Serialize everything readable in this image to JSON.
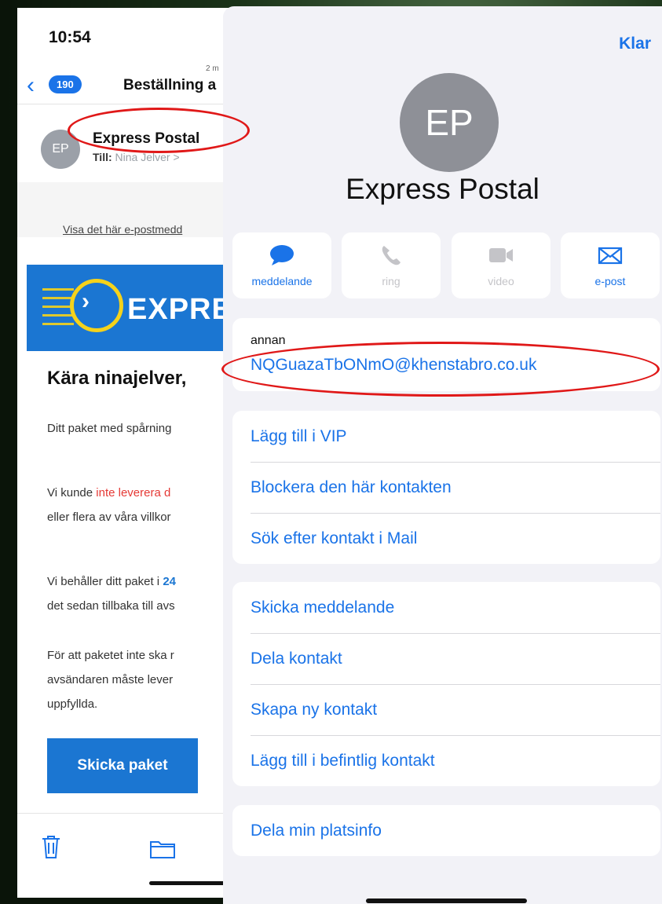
{
  "mail": {
    "status_time": "10:54",
    "back_count": "190",
    "subject_title": "Beställning a",
    "timestamp_fragment": "2 m",
    "sender_initials": "EP",
    "sender_name": "Express Postal",
    "to_label": "Till:",
    "to_value": "Nina Jelver >",
    "view_link": "Visa det här e-postmedd",
    "banner_text": "EXPRES",
    "greeting": "Kära ninajelver,",
    "p1": "Ditt paket med spårning",
    "p2a_prefix": "Vi kunde ",
    "p2a_red": "inte leverera d",
    "p2b": "eller flera av våra villkor",
    "p3a_prefix": "Vi behåller ditt paket i ",
    "p3a_blue": "24",
    "p3b": "det sedan tillbaka till avs",
    "p4a": "För att paketet inte ska r",
    "p4b": "avsändaren måste lever",
    "p4c": "uppfyllda.",
    "send_button": "Skicka paket"
  },
  "contact": {
    "done_label": "Klar",
    "initials": "EP",
    "name": "Express Postal",
    "actions": [
      {
        "label": "meddelande",
        "icon": "message-icon",
        "enabled": true
      },
      {
        "label": "ring",
        "icon": "phone-icon",
        "enabled": false
      },
      {
        "label": "video",
        "icon": "video-icon",
        "enabled": false
      },
      {
        "label": "e-post",
        "icon": "mail-icon",
        "enabled": true
      }
    ],
    "email_label": "annan",
    "email": "NQGuazaTbONmO@khenstabro.co.uk",
    "group1": [
      "Lägg till i VIP",
      "Blockera den här kontakten",
      "Sök efter kontakt i Mail"
    ],
    "group2": [
      "Skicka meddelande",
      "Dela kontakt",
      "Skapa ny kontakt",
      "Lägg till i befintlig kontakt"
    ],
    "group3": [
      "Dela min platsinfo"
    ]
  },
  "colors": {
    "accent": "#1a73e8",
    "annotation": "#e01818",
    "banner": "#1b76d2"
  }
}
